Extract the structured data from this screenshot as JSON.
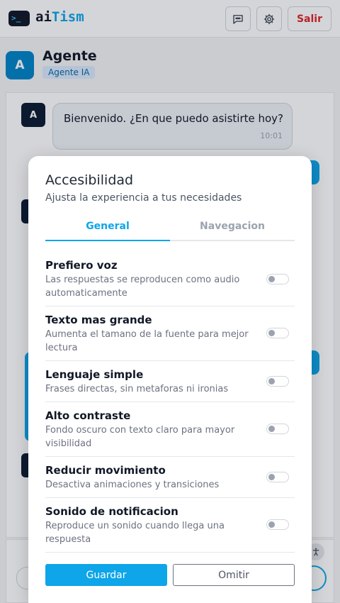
{
  "header": {
    "logo_glyph": ">_",
    "brand_part1": "ai",
    "brand_part2": "Tism",
    "chat_icon": "chat-bubble-icon",
    "settings_icon": "gear-icon",
    "logout_label": "Salir"
  },
  "agent": {
    "avatar_letter": "A",
    "name": "Agente",
    "badge": "Agente IA"
  },
  "chat": {
    "messages": [
      {
        "avatar": "A",
        "text": "Bienvenido. ¿En que puedo asistirte hoy?",
        "time": "10:01"
      }
    ]
  },
  "modal": {
    "title": "Accesibilidad",
    "subtitle": "Ajusta la experiencia a tus necesidades",
    "tabs": [
      {
        "label": "General",
        "active": true
      },
      {
        "label": "Navegacion",
        "active": false
      }
    ],
    "options": [
      {
        "title": "Prefiero voz",
        "desc": "Las respuestas se reproducen como audio automaticamente",
        "enabled": false
      },
      {
        "title": "Texto mas grande",
        "desc": "Aumenta el tamano de la fuente para mejor lectura",
        "enabled": false
      },
      {
        "title": "Lenguaje simple",
        "desc": "Frases directas, sin metaforas ni ironias",
        "enabled": false
      },
      {
        "title": "Alto contraste",
        "desc": "Fondo oscuro con texto claro para mayor visibilidad",
        "enabled": false
      },
      {
        "title": "Reducir movimiento",
        "desc": "Desactiva animaciones y transiciones",
        "enabled": false
      },
      {
        "title": "Sonido de notificacion",
        "desc": "Reproduce un sonido cuando llega una respuesta",
        "enabled": false
      }
    ],
    "save_label": "Guardar",
    "skip_label": "Omitir"
  },
  "colors": {
    "accent": "#0ea5e9",
    "danger": "#dc2626",
    "dark": "#0b1b33"
  }
}
